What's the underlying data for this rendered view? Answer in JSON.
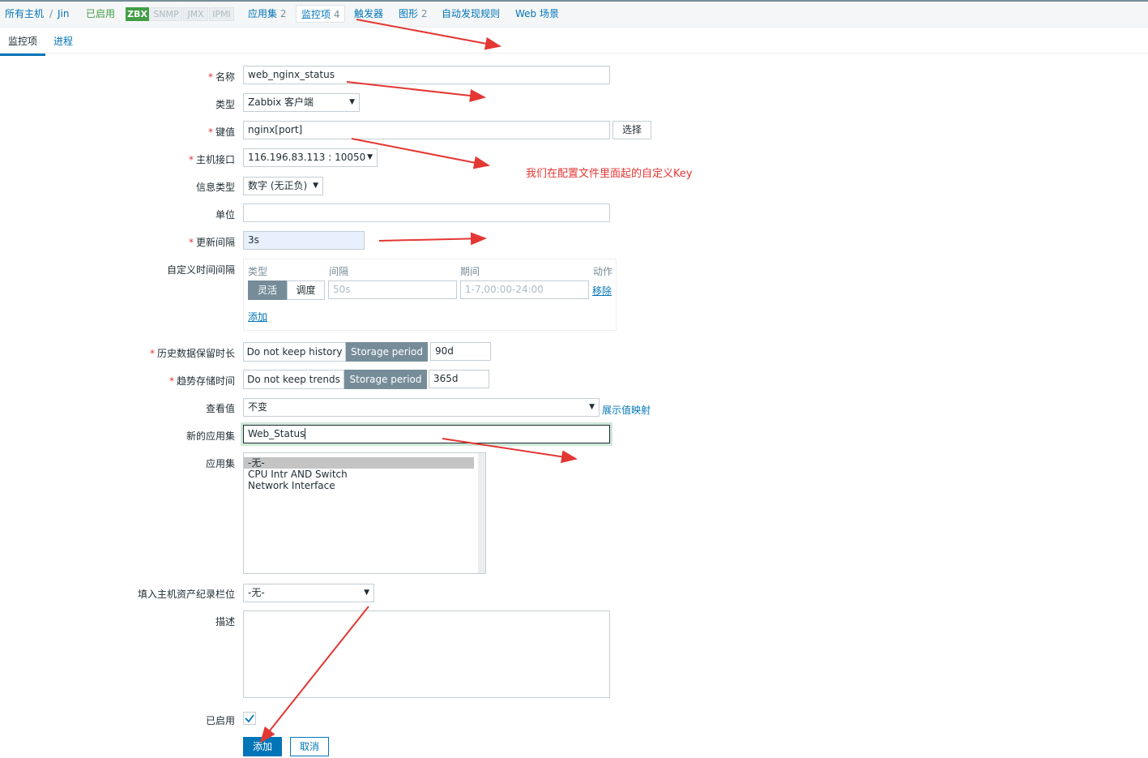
{
  "breadcrumb": {
    "all_hosts": "所有主机",
    "sep": "/",
    "host": "Jin"
  },
  "status": {
    "enabled": "已启用"
  },
  "badges": {
    "zbx": "ZBX",
    "snmp": "SNMP",
    "jmx": "JMX",
    "ipmi": "IPMI"
  },
  "nav": {
    "applications": "应用集",
    "applications_count": "2",
    "items": "监控项",
    "items_count": "4",
    "triggers": "触发器",
    "graphs": "图形",
    "graphs_count": "2",
    "discovery": "自动发现规则",
    "web": "Web 场景"
  },
  "subtabs": {
    "item": "监控项",
    "process": "进程"
  },
  "form": {
    "name_label": "名称",
    "name_value": "web_nginx_status",
    "type_label": "类型",
    "type_value": "Zabbix 客户端",
    "key_label": "键值",
    "key_value": "nginx[port]",
    "select_button": "选择",
    "interface_label": "主机接口",
    "interface_value": "116.196.83.113 : 10050",
    "info_type_label": "信息类型",
    "info_type_value": "数字 (无正负)",
    "units_label": "单位",
    "units_value": "",
    "interval_label": "更新间隔",
    "interval_value": "3s",
    "custom_label": "自定义时间间隔",
    "custom": {
      "col_type": "类型",
      "col_interval": "间隔",
      "col_period": "期间",
      "col_action": "动作",
      "flexible": "灵活",
      "scheduling": "调度",
      "interval_placeholder": "50s",
      "period_placeholder": "1-7,00:00-24:00",
      "remove": "移除",
      "add": "添加"
    },
    "history_label": "历史数据保留时长",
    "history_no_keep": "Do not keep history",
    "history_storage": "Storage period",
    "history_value": "90d",
    "trends_label": "趋势存储时间",
    "trends_no_keep": "Do not keep trends",
    "trends_storage": "Storage period",
    "trends_value": "365d",
    "valuemap_label": "查看值",
    "valuemap_value": "不变",
    "valuemap_link": "展示值映射",
    "new_app_label": "新的应用集",
    "new_app_value": "Web_Status",
    "apps_label": "应用集",
    "apps": [
      "-无-",
      "CPU Intr AND Switch",
      "Network Interface"
    ],
    "inventory_label": "填入主机资产纪录栏位",
    "inventory_value": "-无-",
    "desc_label": "描述",
    "desc_value": "",
    "enabled_label": "已启用",
    "add_button": "添加",
    "cancel_button": "取消"
  },
  "annotation": {
    "text": "我们在配置文件里面起的自定义Key"
  },
  "colors": {
    "accent": "#0275b8",
    "enabled_green": "#429e47",
    "annotation_red": "#e33734",
    "active_seg": "#768d99"
  }
}
